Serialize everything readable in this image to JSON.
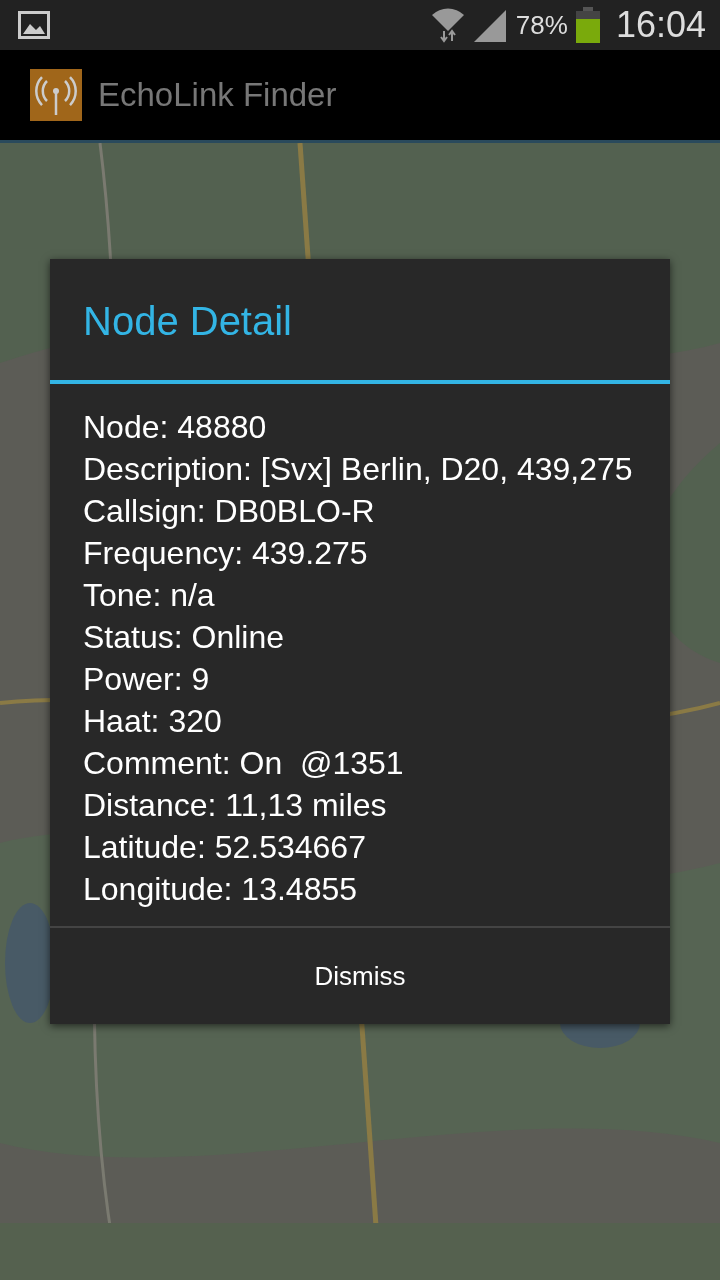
{
  "status_bar": {
    "battery": "78%",
    "time": "16:04"
  },
  "app_bar": {
    "title": "EchoLink Finder"
  },
  "dialog": {
    "title": "Node Detail",
    "lines": [
      "Node: 48880",
      "Description: [Svx] Berlin, D20, 439,275",
      "Callsign: DB0BLO-R",
      "Frequency: 439.275",
      "Tone: n/a",
      "Status: Online",
      "Power: 9",
      "Haat: 320",
      "Comment: On  @1351",
      "Distance: 11,13 miles",
      "Latitude: 52.534667",
      "Longitude: 13.4855"
    ],
    "button": "Dismiss"
  }
}
